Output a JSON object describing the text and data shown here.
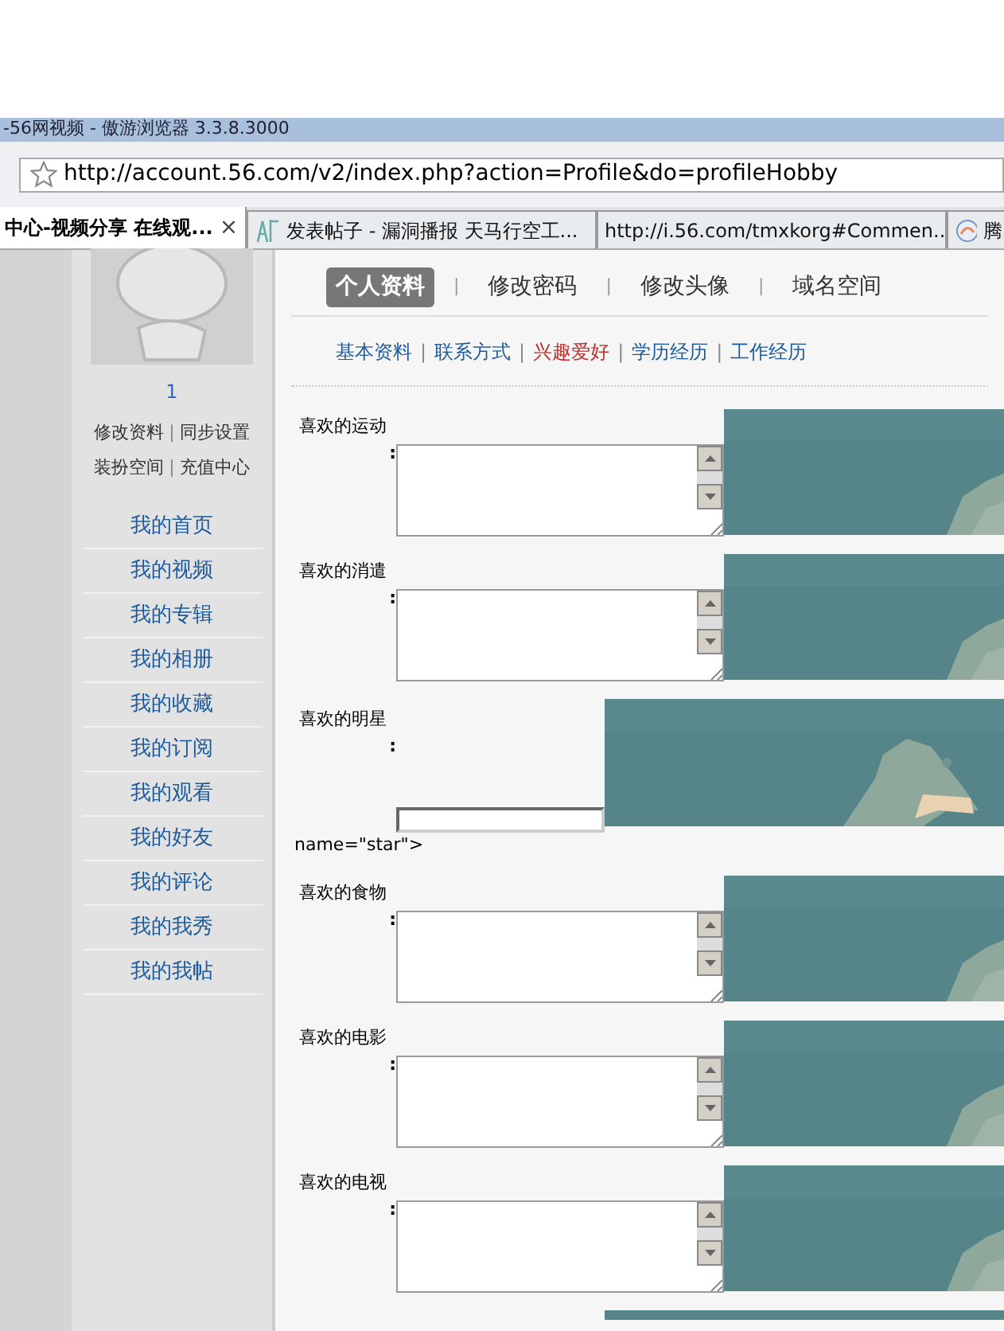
{
  "window": {
    "title": "-56网视频 - 傲游浏览器 3.3.8.3000"
  },
  "address_bar": {
    "value": "http://account.56.com/v2/index.php?action=Profile&do=profileHobby"
  },
  "tabs": [
    {
      "label": "中心-视频分享 在线观...",
      "selected": true,
      "close": "×"
    },
    {
      "label": "发表帖子 - 漏洞播报 天马行空工...",
      "selected": false
    },
    {
      "label": "http://i.56.com/tmxkorg#Commen...",
      "selected": false
    },
    {
      "label": "腾",
      "selected": false
    }
  ],
  "sidebar": {
    "user_name": "1",
    "links": [
      {
        "left": "修改资料",
        "separator": "|",
        "right": "同步设置"
      },
      {
        "left": "装扮空间",
        "separator": "|",
        "right": "充值中心"
      }
    ],
    "items": [
      "我的首页",
      "我的视频",
      "我的专辑",
      "我的相册",
      "我的收藏",
      "我的订阅",
      "我的观看",
      "我的好友",
      "我的评论",
      "我的我秀",
      "我的我帖"
    ]
  },
  "main_tabs": [
    {
      "label": "个人资料",
      "selected": true
    },
    {
      "separator": "|",
      "label": "修改密码",
      "selected": false
    },
    {
      "separator": "|",
      "label": "修改头像",
      "selected": false
    },
    {
      "separator": "|",
      "label": "域名空间",
      "selected": false
    }
  ],
  "sub_tabs": [
    {
      "label": "基本资料",
      "selected": false
    },
    {
      "separator": "|",
      "label": "联系方式",
      "selected": false
    },
    {
      "separator": "|",
      "label": "兴趣爱好",
      "selected": true
    },
    {
      "separator": "|",
      "label": "学历经历",
      "selected": false
    },
    {
      "separator": "|",
      "label": "工作经历",
      "selected": false
    }
  ],
  "fields": [
    {
      "kind": "textarea",
      "label": "喜欢的运动",
      "colon": ":"
    },
    {
      "kind": "textarea",
      "label": "喜欢的消遣",
      "colon": ":"
    },
    {
      "kind": "input",
      "label": "喜欢的明星",
      "colon": ":",
      "trailing_text": "name=\"star\">"
    },
    {
      "kind": "textarea",
      "label": "喜欢的食物",
      "colon": ":"
    },
    {
      "kind": "textarea",
      "label": "喜欢的电影",
      "colon": ":"
    },
    {
      "kind": "textarea",
      "label": "喜欢的电视",
      "colon": ":"
    },
    {
      "kind": "partial"
    }
  ]
}
